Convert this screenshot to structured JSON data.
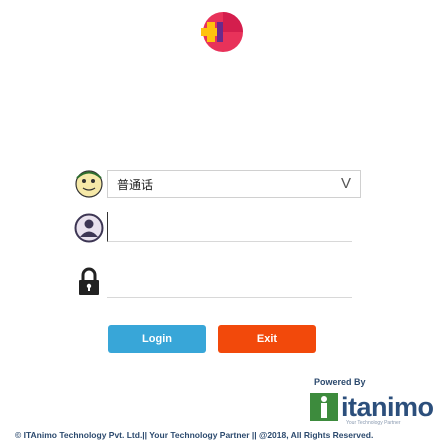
{
  "language": {
    "selected": "普通话",
    "arrow": "V"
  },
  "username": {
    "value": "",
    "placeholder": ""
  },
  "password": {
    "value": "",
    "placeholder": ""
  },
  "buttons": {
    "login": "Login",
    "exit": "Exit"
  },
  "powered_by": "Powered By",
  "brand": {
    "name": "itanimo",
    "tagline": "Your Technology Partner"
  },
  "footer": "© ITAnimo Technology Pvt. Ltd.|| Your Technology Partner || @2018, All Rights Reserved.",
  "colors": {
    "login": "#38a6d8",
    "exit": "#f2490b",
    "brand_green": "#3d8b3d",
    "brand_blue": "#2c4f7c"
  },
  "icons": [
    "app-logo-icon",
    "language-avatar-icon",
    "user-icon",
    "lock-icon",
    "itanimo-logo-icon"
  ]
}
